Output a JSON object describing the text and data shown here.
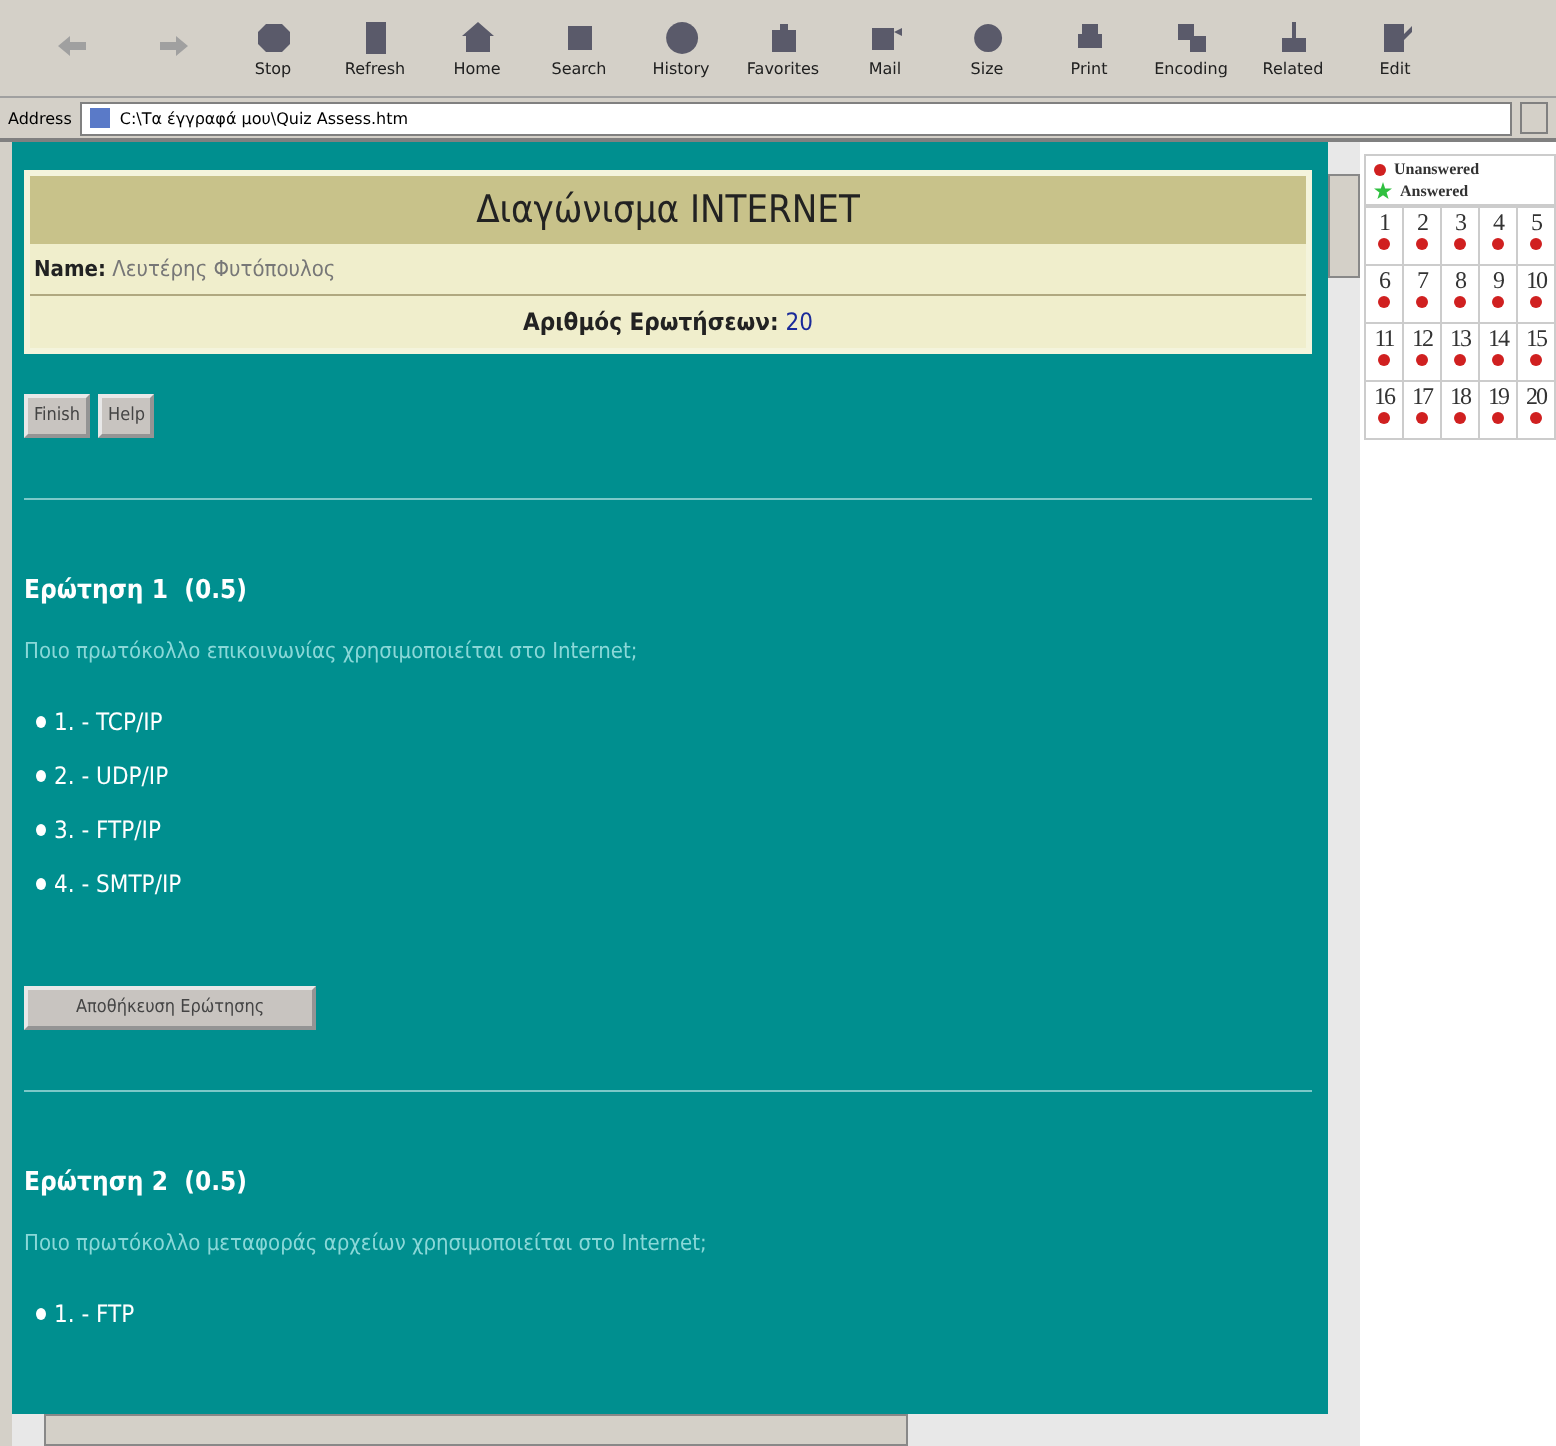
{
  "toolbar": [
    {
      "kind": "back",
      "disabled": true
    },
    {
      "kind": "forward",
      "disabled": true
    },
    {
      "kind": "stop",
      "label": "Stop",
      "disabled": false
    },
    {
      "kind": "refresh",
      "label": "Refresh",
      "disabled": false
    },
    {
      "kind": "home",
      "label": "Home",
      "disabled": false
    },
    {
      "kind": "search",
      "label": "Search",
      "disabled": false
    },
    {
      "kind": "history",
      "label": "History",
      "disabled": false
    },
    {
      "kind": "favorites",
      "label": "Favorites",
      "disabled": false
    },
    {
      "kind": "mail",
      "label": "Mail",
      "disabled": false
    },
    {
      "kind": "size",
      "label": "Size",
      "disabled": false
    },
    {
      "kind": "print",
      "label": "Print",
      "disabled": false
    },
    {
      "kind": "encoding",
      "label": "Encoding",
      "disabled": false
    },
    {
      "kind": "related",
      "label": "Related",
      "disabled": false
    },
    {
      "kind": "edit",
      "label": "Edit",
      "disabled": false
    }
  ],
  "address": {
    "label": "Address",
    "value": "C:\\Τα έγγραφά μου\\Quiz Assess.htm"
  },
  "quiz": {
    "title": "Διαγώνισμα INTERNET",
    "name_label": "Name:",
    "name_value": "Λευτέρης Φυτόπουλος",
    "count_label": "Αριθμός Ερωτήσεων:",
    "count_value": "20"
  },
  "buttons": [
    "Finish",
    "Help"
  ],
  "questions": [
    {
      "heading": "Ερώτηση 1  (0.5)",
      "text": "Ποιο πρωτόκολλο επικοινωνίας χρησιμοποιείται στο Internet;",
      "options": [
        "1. - TCP/IP",
        "2. - UDP/IP",
        "3. - FTP/IP",
        "4. - SMTP/IP"
      ],
      "save_button": "Αποθήκευση Ερώτησης"
    },
    {
      "heading": "Ερώτηση 2  (0.5)",
      "text": "Ποιο πρωτόκολλο μεταφοράς αρχείων χρησιμοποιείται στο Internet;",
      "options": [
        "1. - FTP"
      ]
    }
  ],
  "legend": [
    {
      "label": "Unanswered",
      "answered": false
    },
    {
      "label": "Answered",
      "answered": true
    }
  ],
  "question_grid": [
    {
      "number": "1",
      "answered": false
    },
    {
      "number": "2",
      "answered": false
    },
    {
      "number": "3",
      "answered": false
    },
    {
      "number": "4",
      "answered": false
    },
    {
      "number": "5",
      "answered": false
    },
    {
      "number": "6",
      "answered": false
    },
    {
      "number": "7",
      "answered": false
    },
    {
      "number": "8",
      "answered": false
    },
    {
      "number": "9",
      "answered": false
    },
    {
      "number": "10",
      "answered": false
    },
    {
      "number": "11",
      "answered": false
    },
    {
      "number": "12",
      "answered": false
    },
    {
      "number": "13",
      "answered": false
    },
    {
      "number": "14",
      "answered": false
    },
    {
      "number": "15",
      "answered": false
    },
    {
      "number": "16",
      "answered": false
    },
    {
      "number": "17",
      "answered": false
    },
    {
      "number": "18",
      "answered": false
    },
    {
      "number": "19",
      "answered": false
    },
    {
      "number": "20",
      "answered": false
    }
  ]
}
